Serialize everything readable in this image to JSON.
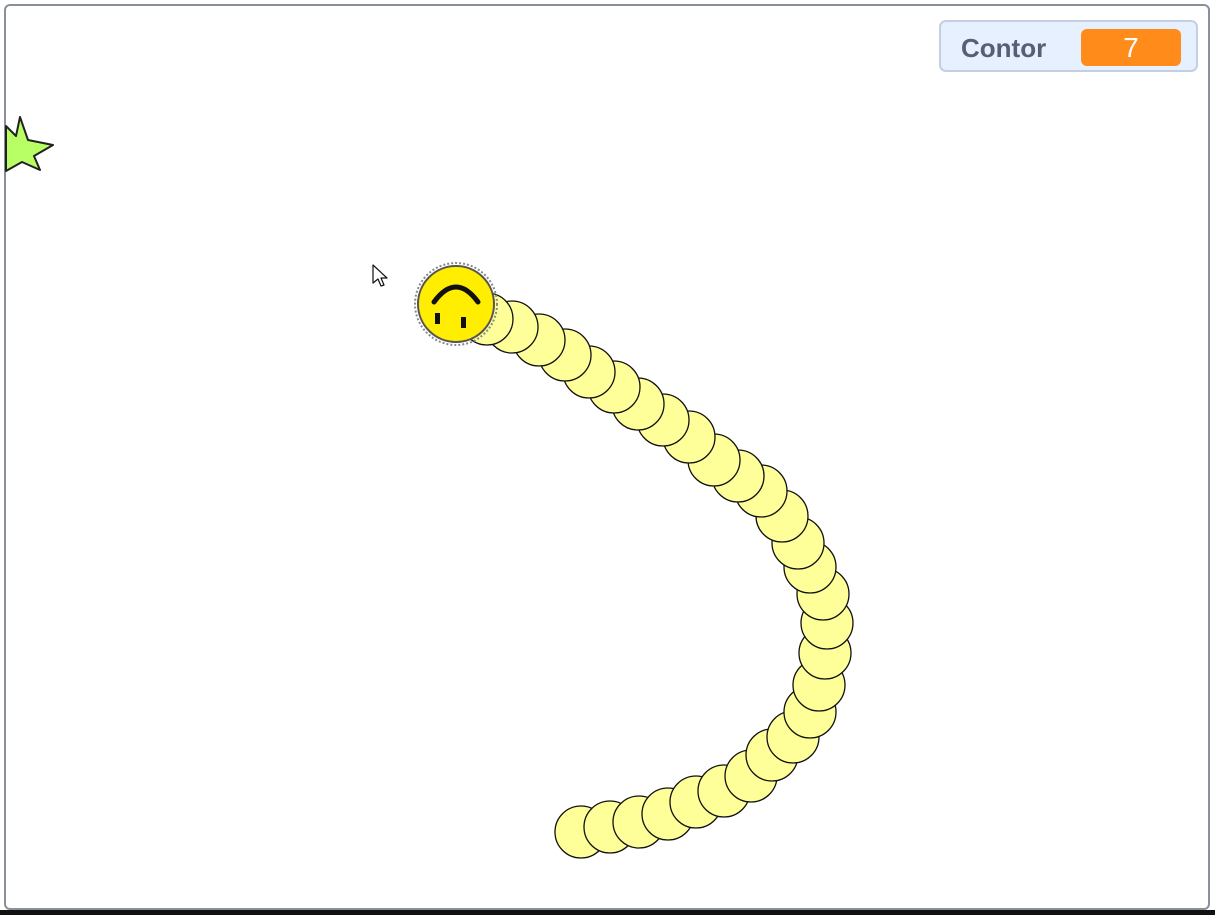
{
  "monitor": {
    "label": "Contor",
    "value": "7"
  },
  "colors": {
    "monitor_value_bg": "#ff8c1a",
    "body_segment_fill": "#ffff99",
    "head_fill": "#ffee00",
    "star_fill": "#b8ff66"
  },
  "icons": {
    "head": "smiley-face-icon",
    "food": "star-icon",
    "pointer": "mouse-cursor-icon"
  }
}
